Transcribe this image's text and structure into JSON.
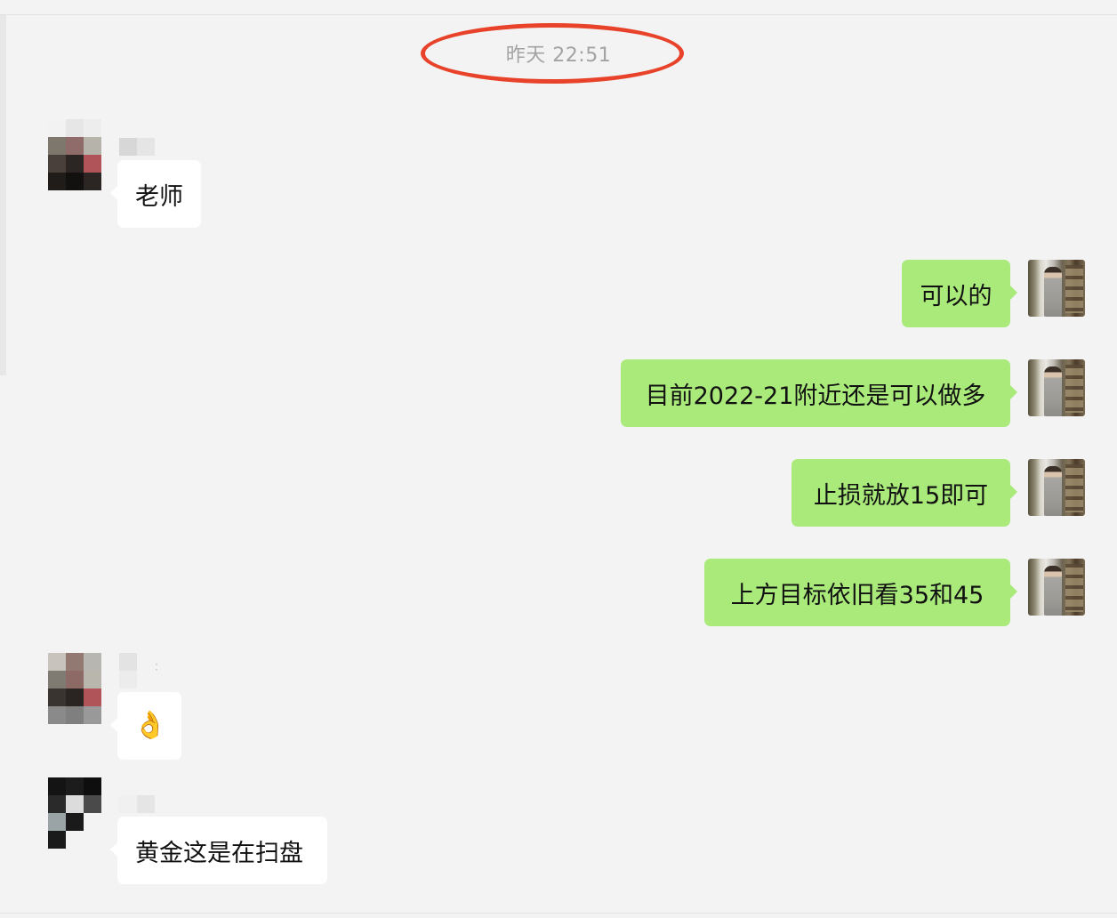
{
  "chat": {
    "timestamp": "昨天 22:51",
    "messages": [
      {
        "direction": "incoming",
        "text": "老师"
      },
      {
        "direction": "outgoing",
        "text": "可以的"
      },
      {
        "direction": "outgoing",
        "text": "目前2022-21附近还是可以做多"
      },
      {
        "direction": "outgoing",
        "text": "止损就放15即可"
      },
      {
        "direction": "outgoing",
        "text": "上方目标依旧看35和45"
      },
      {
        "direction": "incoming",
        "text": "👌"
      },
      {
        "direction": "incoming",
        "text": "黄金这是在扫盘"
      }
    ]
  },
  "colors": {
    "background": "#f3f3f3",
    "incoming_bubble": "#ffffff",
    "outgoing_bubble": "#a9ea7a",
    "highlight": "#e8432a",
    "timestamp_text": "#a3a3a3"
  }
}
